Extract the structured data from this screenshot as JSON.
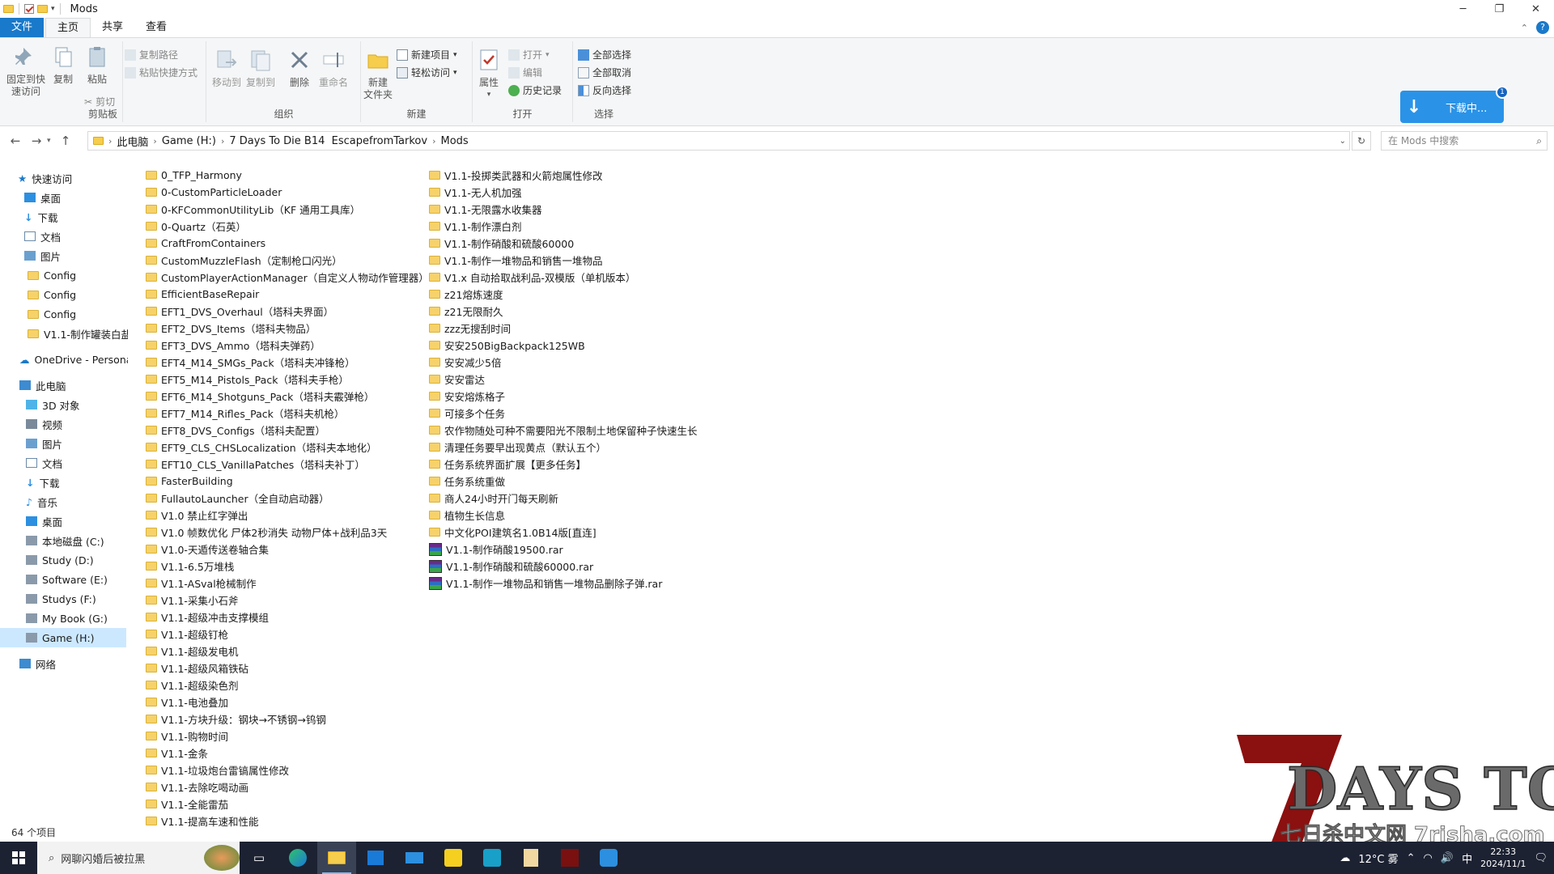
{
  "window": {
    "title": "Mods",
    "min": "─",
    "max": "❐",
    "close": "✕"
  },
  "ribbon_tabs": [
    {
      "label": "文件"
    },
    {
      "label": "主页"
    },
    {
      "label": "共享"
    },
    {
      "label": "查看"
    }
  ],
  "ribbon": {
    "clipboard": {
      "group": "剪贴板",
      "pin_l1": "固定到快",
      "pin_l2": "速访问",
      "copy": "复制",
      "paste": "粘贴",
      "copy_path": "复制路径",
      "paste_shortcut": "粘贴快捷方式",
      "cut": "剪切"
    },
    "organize": {
      "group": "组织",
      "move_to": "移动到",
      "copy_to": "复制到",
      "delete": "删除",
      "rename": "重命名"
    },
    "new": {
      "group": "新建",
      "new_folder_l1": "新建",
      "new_folder_l2": "文件夹",
      "new_item": "新建项目",
      "easy_access": "轻松访问"
    },
    "open": {
      "group": "打开",
      "properties": "属性",
      "open": "打开",
      "edit": "编辑",
      "history": "历史记录"
    },
    "select": {
      "group": "选择",
      "select_all": "全部选择",
      "select_none": "全部取消",
      "invert": "反向选择"
    }
  },
  "download": {
    "label": "下载中...",
    "badge": "1"
  },
  "address": {
    "crumbs": [
      "此电脑",
      "Game (H:)",
      "7 Days To Die B14  EscapefromTarkov",
      "Mods"
    ],
    "search_placeholder": "在 Mods 中搜索"
  },
  "nav_pane": [
    {
      "label": "快速访问",
      "icon": "star-icon"
    },
    {
      "label": "桌面",
      "icon": "desktop-icon",
      "pin": true
    },
    {
      "label": "下载",
      "icon": "download-icon",
      "pin": true
    },
    {
      "label": "文档",
      "icon": "document-icon",
      "pin": true
    },
    {
      "label": "图片",
      "icon": "picture-icon",
      "pin": true
    },
    {
      "label": "Config",
      "icon": "folder-icon"
    },
    {
      "label": "Config",
      "icon": "folder-icon"
    },
    {
      "label": "Config",
      "icon": "folder-icon"
    },
    {
      "label": "V1.1-制作罐装白盐",
      "icon": "folder-icon"
    },
    {
      "label": "OneDrive - Persona",
      "icon": "cloud-icon"
    },
    {
      "label": "此电脑",
      "icon": "pc-icon"
    },
    {
      "label": "3D 对象",
      "icon": "cube-icon"
    },
    {
      "label": "视频",
      "icon": "video-icon"
    },
    {
      "label": "图片",
      "icon": "picture-icon"
    },
    {
      "label": "文档",
      "icon": "document-icon"
    },
    {
      "label": "下载",
      "icon": "download-icon"
    },
    {
      "label": "音乐",
      "icon": "music-icon"
    },
    {
      "label": "桌面",
      "icon": "desktop-icon"
    },
    {
      "label": "本地磁盘 (C:)",
      "icon": "drive-icon"
    },
    {
      "label": "Study (D:)",
      "icon": "drive-icon"
    },
    {
      "label": "Software (E:)",
      "icon": "drive-icon"
    },
    {
      "label": "Studys (F:)",
      "icon": "drive-icon"
    },
    {
      "label": "My Book (G:)",
      "icon": "drive-icon"
    },
    {
      "label": "Game (H:)",
      "icon": "drive-icon",
      "selected": true
    },
    {
      "label": "网络",
      "icon": "network-icon"
    }
  ],
  "files_col1": [
    "0_TFP_Harmony",
    "0-CustomParticleLoader",
    "0-KFCommonUtilityLib（KF 通用工具库）",
    "0-Quartz（石英）",
    "CraftFromContainers",
    "CustomMuzzleFlash（定制枪口闪光）",
    "CustomPlayerActionManager（自定义人物动作管理器）",
    "EfficientBaseRepair",
    "EFT1_DVS_Overhaul（塔科夫界面）",
    "EFT2_DVS_Items（塔科夫物品）",
    "EFT3_DVS_Ammo（塔科夫弹药）",
    "EFT4_M14_SMGs_Pack（塔科夫冲锋枪）",
    "EFT5_M14_Pistols_Pack（塔科夫手枪）",
    "EFT6_M14_Shotguns_Pack（塔科夫霰弹枪）",
    "EFT7_M14_Rifles_Pack（塔科夫机枪）",
    "EFT8_DVS_Configs（塔科夫配置）",
    "EFT9_CLS_CHSLocalization（塔科夫本地化）",
    "EFT10_CLS_VanillaPatches（塔科夫补丁）",
    "FasterBuilding",
    "FullautoLauncher（全自动启动器）",
    "V1.0 禁止红字弹出",
    "V1.0 帧数优化 尸体2秒消失 动物尸体+战利品3天",
    "V1.0-天遁传送卷轴合集",
    "V1.1-6.5万堆栈",
    "V1.1-ASval枪械制作",
    "V1.1-采集小石斧",
    "V1.1-超级冲击支撑模组",
    "V1.1-超级钉枪",
    "V1.1-超级发电机",
    "V1.1-超级风箱铁砧",
    "V1.1-超级染色剂",
    "V1.1-电池叠加",
    "V1.1-方块升级：钢块→不锈钢→钨钢",
    "V1.1-购物时间",
    "V1.1-金条",
    "V1.1-垃圾炮台雷镐属性修改",
    "V1.1-去除吃喝动画",
    "V1.1-全能雷茄",
    "V1.1-提高车速和性能"
  ],
  "files_col2": [
    {
      "name": "V1.1-投掷类武器和火箭炮属性修改"
    },
    {
      "name": "V1.1-无人机加强"
    },
    {
      "name": "V1.1-无限露水收集器"
    },
    {
      "name": "V1.1-制作漂白剂"
    },
    {
      "name": "V1.1-制作硝酸和硫酸60000"
    },
    {
      "name": "V1.1-制作一堆物品和销售一堆物品"
    },
    {
      "name": "V1.x 自动拾取战利品-双模版（单机版本）"
    },
    {
      "name": "z21熔炼速度"
    },
    {
      "name": "z21无限耐久"
    },
    {
      "name": "zzz无搜刮时间"
    },
    {
      "name": "安安250BigBackpack125WB"
    },
    {
      "name": "安安减少5倍"
    },
    {
      "name": "安安雷达"
    },
    {
      "name": "安安熔炼格子"
    },
    {
      "name": "可接多个任务"
    },
    {
      "name": "农作物随处可种不需要阳光不限制土地保留种子快速生长"
    },
    {
      "name": "清理任务要早出现黄点（默认五个）"
    },
    {
      "name": "任务系统界面扩展【更多任务】"
    },
    {
      "name": "任务系统重做"
    },
    {
      "name": "商人24小时开门每天刷新"
    },
    {
      "name": "植物生长信息"
    },
    {
      "name": "中文化POI建筑名1.0B14版[直连]"
    },
    {
      "name": "V1.1-制作硝酸19500.rar",
      "rar": true
    },
    {
      "name": "V1.1-制作硝酸和硫酸60000.rar",
      "rar": true
    },
    {
      "name": "V1.1-制作一堆物品和销售一堆物品删除子弹.rar",
      "rar": true
    }
  ],
  "status": {
    "count": "64 个项目"
  },
  "taskbar": {
    "search_text": "网聊闪婚后被拉黑",
    "weather": "12°C 雾",
    "ime": "中",
    "time": "22:33",
    "date": "2024/11/1"
  },
  "watermark": {
    "line1": "DAYS TO DIE",
    "line2": "七日杀中文网 7risha.com"
  },
  "colors": {
    "accent": "#1979ca",
    "taskbar": "#1c2232",
    "folder": "#f7d26a",
    "selected": "#cce8ff"
  }
}
